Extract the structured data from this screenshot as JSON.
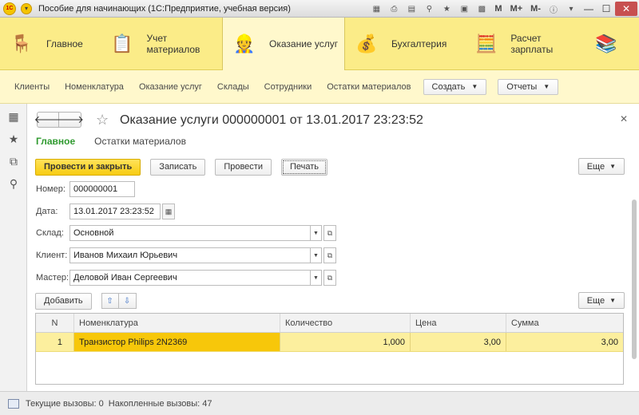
{
  "window": {
    "title": "Пособие для начинающих  (1С:Предприятие, учебная версия)",
    "logo_text": "1С",
    "tools": [
      "M",
      "M+",
      "M-"
    ]
  },
  "sections": [
    {
      "label": "Главное",
      "icon": "desk-lamp-icon",
      "glyph": "🪑"
    },
    {
      "label": "Учет материалов",
      "icon": "clipboard-pencil-icon",
      "glyph": "📋"
    },
    {
      "label": "Оказание услуг",
      "icon": "worker-helmet-icon",
      "glyph": "👷"
    },
    {
      "label": "Бухгалтерия",
      "icon": "coins-icon",
      "glyph": "💰"
    },
    {
      "label": "Расчет зарплаты",
      "icon": "calculator-money-icon",
      "glyph": "🧮"
    }
  ],
  "functions": {
    "links": [
      "Клиенты",
      "Номенклатура",
      "Оказание услуг",
      "Склады",
      "Сотрудники",
      "Остатки материалов"
    ],
    "create_label": "Создать",
    "reports_label": "Отчеты"
  },
  "form": {
    "title": "Оказание услуги 000000001 от 13.01.2017 23:23:52",
    "tabs": [
      "Главное",
      "Остатки материалов"
    ],
    "buttons": {
      "post_close": "Провести и закрыть",
      "save": "Записать",
      "post": "Провести",
      "print": "Печать",
      "more": "Еще"
    },
    "fields": {
      "number_label": "Номер:",
      "number_value": "000000001",
      "date_label": "Дата:",
      "date_value": "13.01.2017 23:23:52",
      "warehouse_label": "Склад:",
      "warehouse_value": "Основной",
      "client_label": "Клиент:",
      "client_value": "Иванов Михаил Юрьевич",
      "master_label": "Мастер:",
      "master_value": "Деловой Иван Сергеевич"
    },
    "table": {
      "add_label": "Добавить",
      "more_label": "Еще",
      "columns": [
        "N",
        "Номенклатура",
        "Количество",
        "Цена",
        "Сумма"
      ],
      "rows": [
        {
          "n": "1",
          "item": "Транзистор Philips 2N2369",
          "qty": "1,000",
          "price": "3,00",
          "sum": "3,00"
        }
      ]
    }
  },
  "status": {
    "current_calls": "Текущие вызовы: 0",
    "accumulated_calls": "Накопленные вызовы: 47"
  }
}
